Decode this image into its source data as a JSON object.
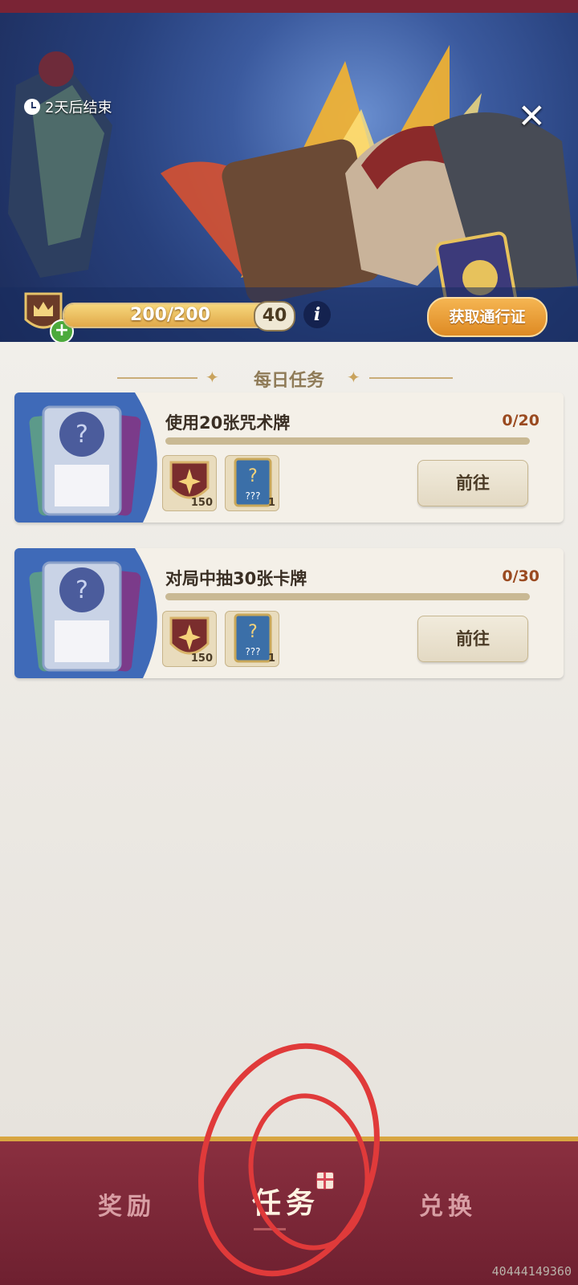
{
  "banner": {
    "timer_text": "2天后结束",
    "close_glyph": "✕",
    "xp": "200/200",
    "xp_fraction": 1.0,
    "level": "40",
    "info_glyph": "i",
    "get_pass_label": "获取通行证"
  },
  "section": {
    "title": "每日任务"
  },
  "tasks": [
    {
      "title": "使用20张咒术牌",
      "progress": "0/20",
      "progress_fraction": 0,
      "rewards": [
        {
          "icon": "shield-star-icon",
          "count": "150"
        },
        {
          "icon": "mystery-card-icon",
          "count": "1"
        }
      ],
      "button_label": "前往"
    },
    {
      "title": "对局中抽30张卡牌",
      "progress": "0/30",
      "progress_fraction": 0,
      "rewards": [
        {
          "icon": "shield-star-icon",
          "count": "150"
        },
        {
          "icon": "mystery-card-icon",
          "count": "1"
        }
      ],
      "button_label": "前往"
    }
  ],
  "mystery_card_text": "???",
  "nav": {
    "rewards": "奖励",
    "tasks": "任务",
    "exchange": "兑换"
  },
  "footer_number": "40444149360",
  "colors": {
    "accent_orange": "#de8a24",
    "nav_bg": "#7a2435",
    "gold": "#d8a641"
  }
}
